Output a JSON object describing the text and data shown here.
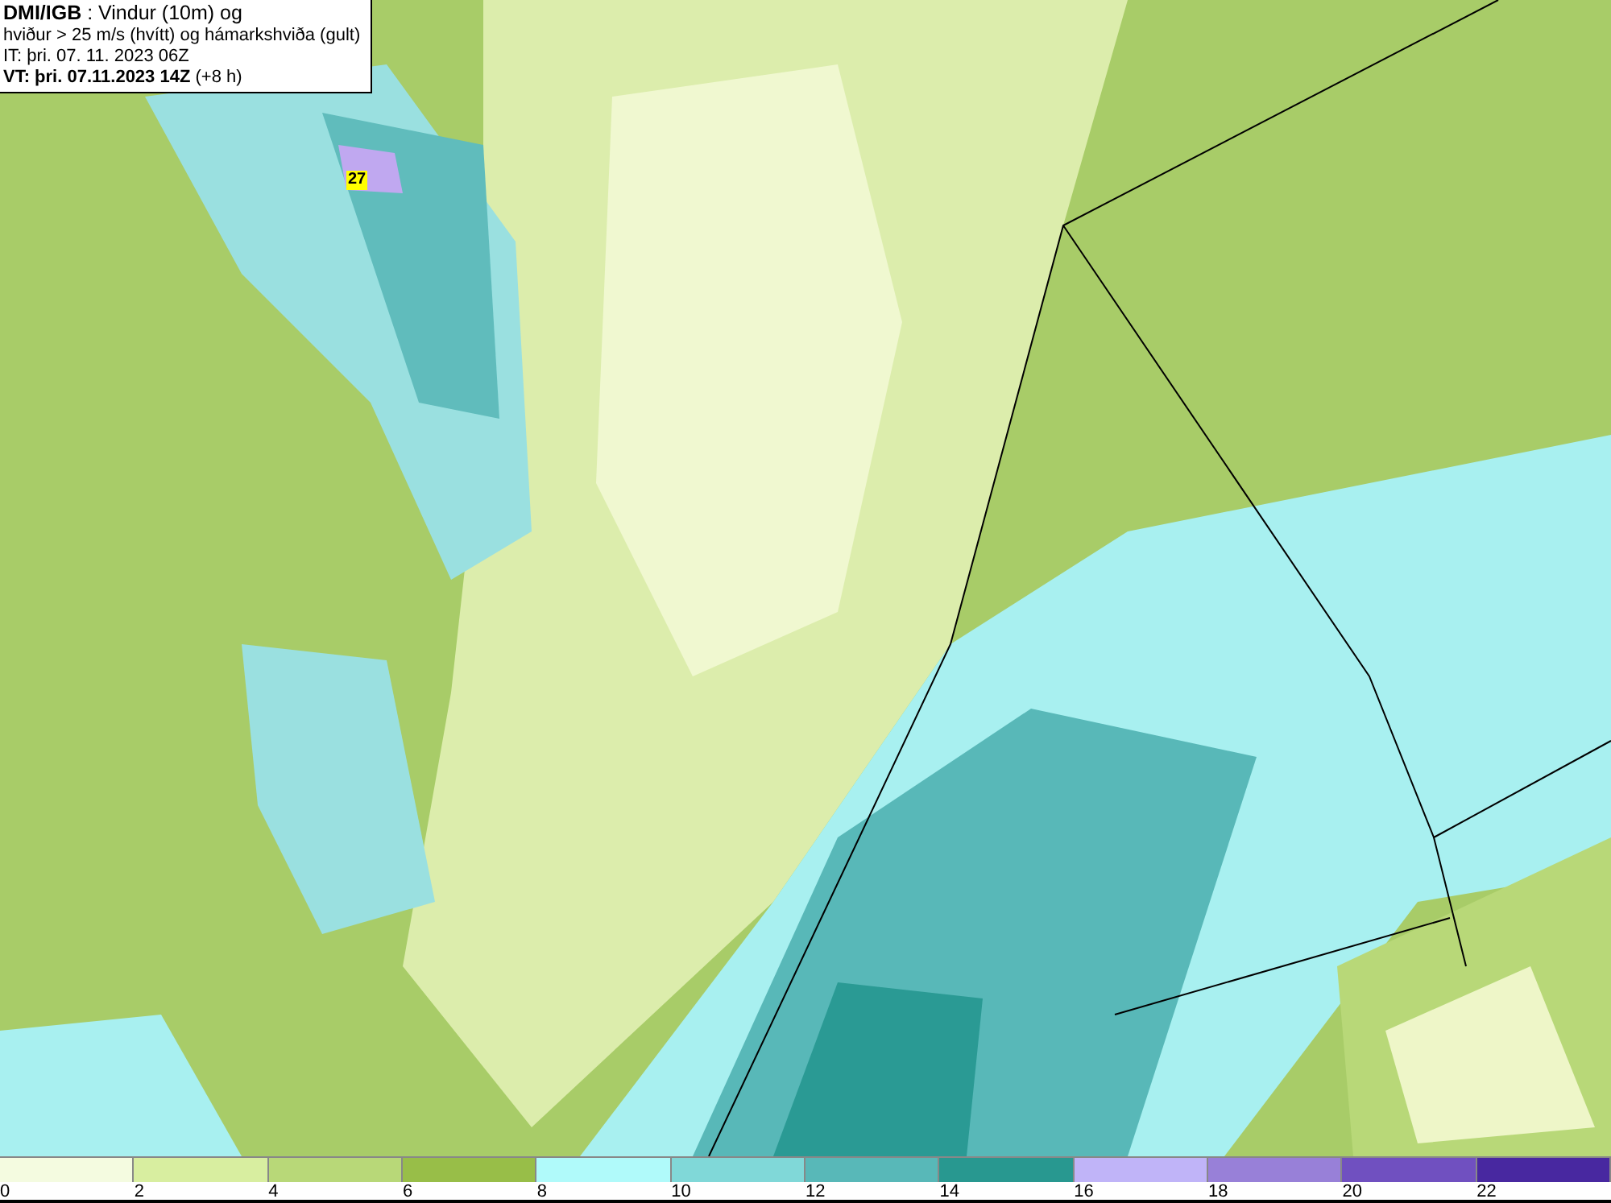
{
  "title_box": {
    "lines": [
      "**DMI/IGB** : Vindur (10m) og",
      "hviður > 25 m/s (hvítt) og hámarkshviða (gult)",
      "IT: þri. 07. 11. 2023 06Z",
      "**VT: þri. 07.11.2023 14Z** (+8 h)"
    ]
  },
  "map": {
    "gust_label": "27"
  },
  "legend": [
    {
      "label": "0",
      "color": "#f4fbe0"
    },
    {
      "label": "2",
      "color": "#d8eea0"
    },
    {
      "label": "4",
      "color": "#b8d878"
    },
    {
      "label": "6",
      "color": "#98be48"
    },
    {
      "label": "8",
      "color": "#b0fafa"
    },
    {
      "label": "10",
      "color": "#80d8d8"
    },
    {
      "label": "12",
      "color": "#58b8b8"
    },
    {
      "label": "14",
      "color": "#289890"
    },
    {
      "label": "16",
      "color": "#c0b4f8"
    },
    {
      "label": "18",
      "color": "#9880d8"
    },
    {
      "label": "20",
      "color": "#7050c0"
    },
    {
      "label": "22",
      "color": "#4828a0"
    }
  ]
}
